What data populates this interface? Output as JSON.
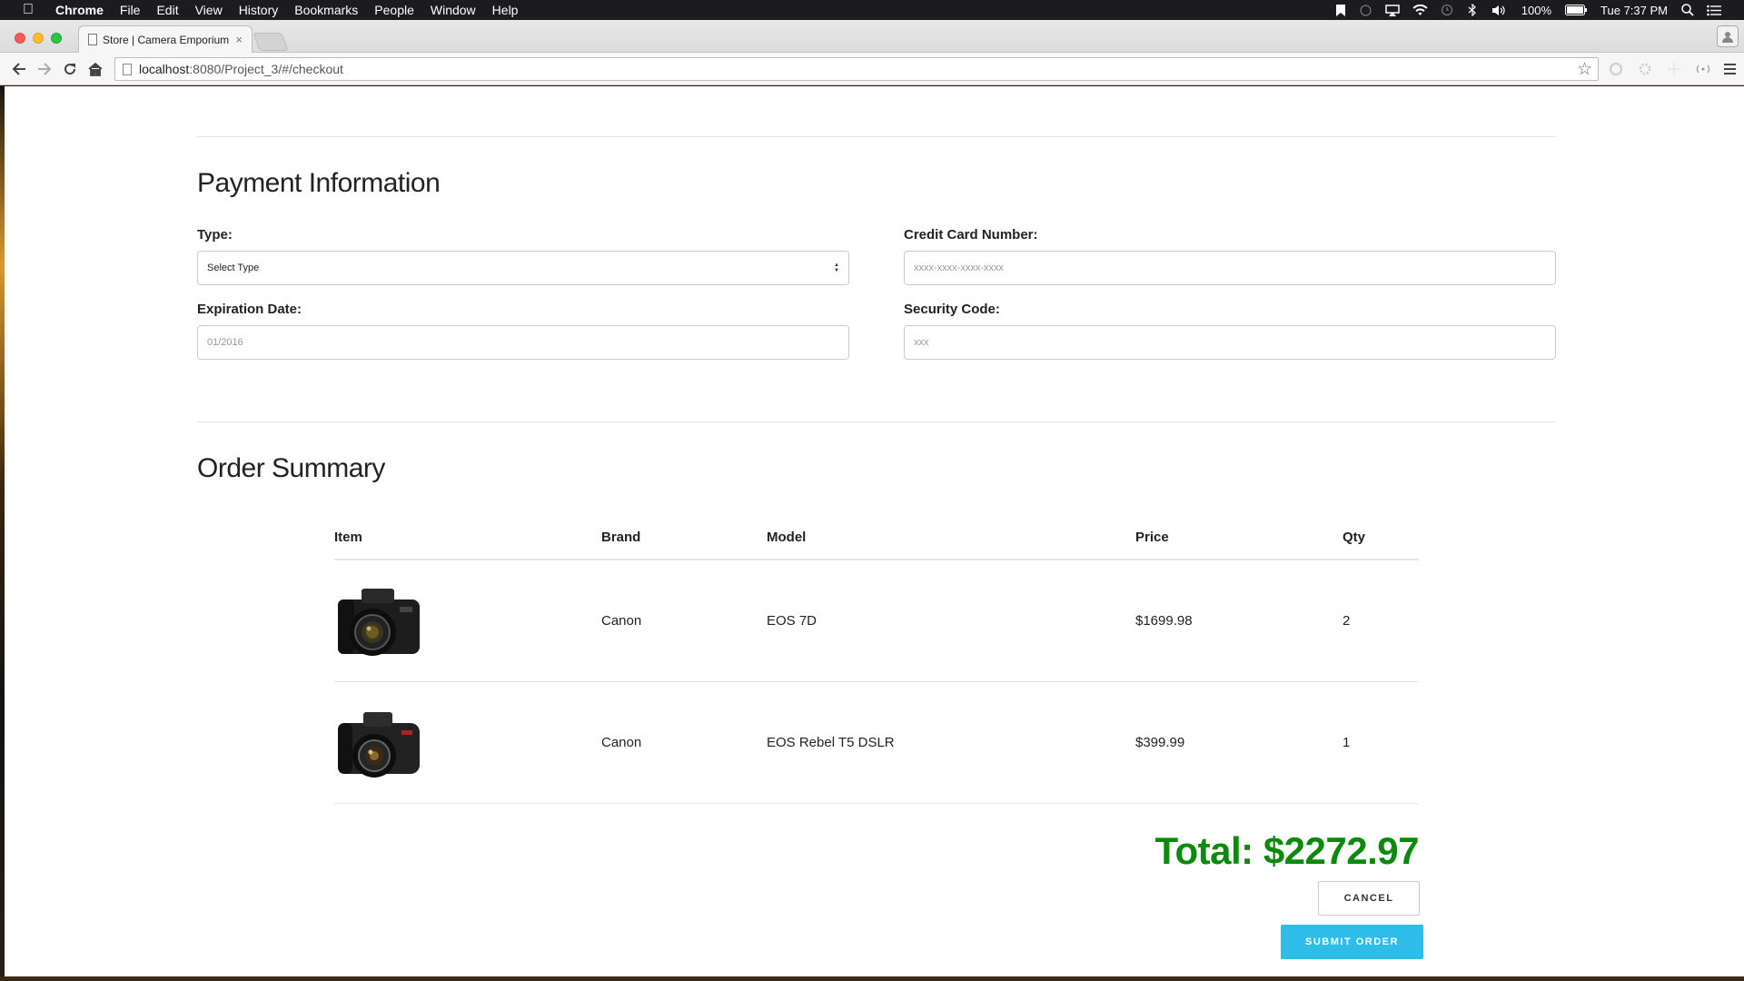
{
  "menubar": {
    "app": "Chrome",
    "menus": [
      "File",
      "Edit",
      "View",
      "History",
      "Bookmarks",
      "People",
      "Window",
      "Help"
    ],
    "battery": "100%",
    "clock": "Tue 7:37 PM"
  },
  "browser": {
    "tab_title": "Store | Camera Emporium",
    "tab_close": "×",
    "url_host": "localhost",
    "url_path": ":8080/Project_3/#/checkout"
  },
  "payment": {
    "heading": "Payment Information",
    "type_label": "Type:",
    "type_value": "Select Type",
    "card_label": "Credit Card Number:",
    "card_placeholder": "xxxx-xxxx-xxxx-xxxx",
    "exp_label": "Expiration Date:",
    "exp_placeholder": "01/2016",
    "code_label": "Security Code:",
    "code_placeholder": "xxx"
  },
  "order": {
    "heading": "Order Summary",
    "columns": [
      "Item",
      "Brand",
      "Model",
      "Price",
      "Qty"
    ],
    "rows": [
      {
        "brand": "Canon",
        "model": "EOS 7D",
        "price": "$1699.98",
        "qty": "2"
      },
      {
        "brand": "Canon",
        "model": "EOS Rebel T5 DSLR",
        "price": "$399.99",
        "qty": "1"
      }
    ],
    "total": "Total: $2272.97",
    "cancel_label": "CANCEL",
    "submit_label": "SUBMIT ORDER"
  },
  "colors": {
    "total_green": "#0b8a0b",
    "submit_blue": "#2ebce9"
  },
  "icons": [
    "apple-icon",
    "bookmark-icon",
    "airplay-icon",
    "wifi-icon",
    "time-machine-icon",
    "bluetooth-icon",
    "volume-icon",
    "battery-icon",
    "spotlight-search-icon",
    "notification-center-icon",
    "back-arrow-icon",
    "forward-arrow-icon",
    "reload-icon",
    "home-icon",
    "page-icon",
    "bookmark-star-icon",
    "chrome-menu-icon",
    "profile-icon",
    "camera-product-image"
  ]
}
